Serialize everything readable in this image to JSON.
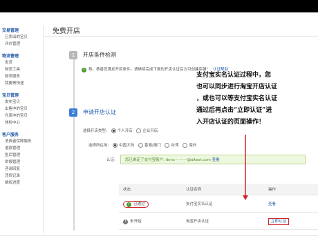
{
  "sidebar": {
    "groups": [
      {
        "head": "交易管理",
        "items": [
          "已卖出的宝贝",
          "评价管理"
        ]
      },
      {
        "head": "物流管理",
        "items": [
          "发货",
          "物流工具",
          "物流服务",
          "我要寄快递"
        ]
      },
      {
        "head": "宝贝管理",
        "items": [
          "发布宝贝",
          "出售中的宝贝",
          "仓库中的宝贝",
          "体检中心"
        ]
      },
      {
        "head": "客户服务",
        "items": [
          "消费者保障服务",
          "退款管理",
          "售后管理",
          "举报管理",
          "咨询回复",
          "违规记录",
          "维权进度"
        ]
      }
    ]
  },
  "main": {
    "title": "免费开店",
    "step1": {
      "num": "1",
      "title": "开店条件检测",
      "notice": "恭，恭喜您满足开店条件，请继续完成下面的开店认证后方可创建店铺！",
      "notice_link": "认证帮助"
    },
    "step2": {
      "num": "2",
      "title": "申请开店认证"
    },
    "store_type": {
      "label": "选择开店类型:",
      "options": [
        "个人开店",
        "企业开店"
      ]
    },
    "location": {
      "label": "选择所在地:",
      "options": [
        "中国大陆",
        "香港/澳门",
        "台湾",
        "海外"
      ]
    },
    "verify": {
      "label": "认证:",
      "text": "您已绑定了支付宝账户: donc··········@altest.com",
      "link": "查看"
    },
    "table": {
      "headers": [
        "状态",
        "认证名称",
        "操作"
      ],
      "rows": [
        {
          "status": "已通过",
          "name": "支付宝实名认证",
          "action": "查看"
        },
        {
          "status": "未开始",
          "name": "淘宝开店认证",
          "action": "立即认证"
        }
      ]
    }
  },
  "callout": {
    "lines": [
      "支付宝实名认证过程中，您",
      "也可以同步进行淘宝开店认证",
      "，或也可以等支付宝实名认证",
      "通过后再点击“立即认证”进",
      "入开店认证的页面操作！"
    ]
  },
  "colors": {
    "accent": "#3b7dd8",
    "annotation": "#d0262a",
    "success": "#4a9a2e"
  }
}
